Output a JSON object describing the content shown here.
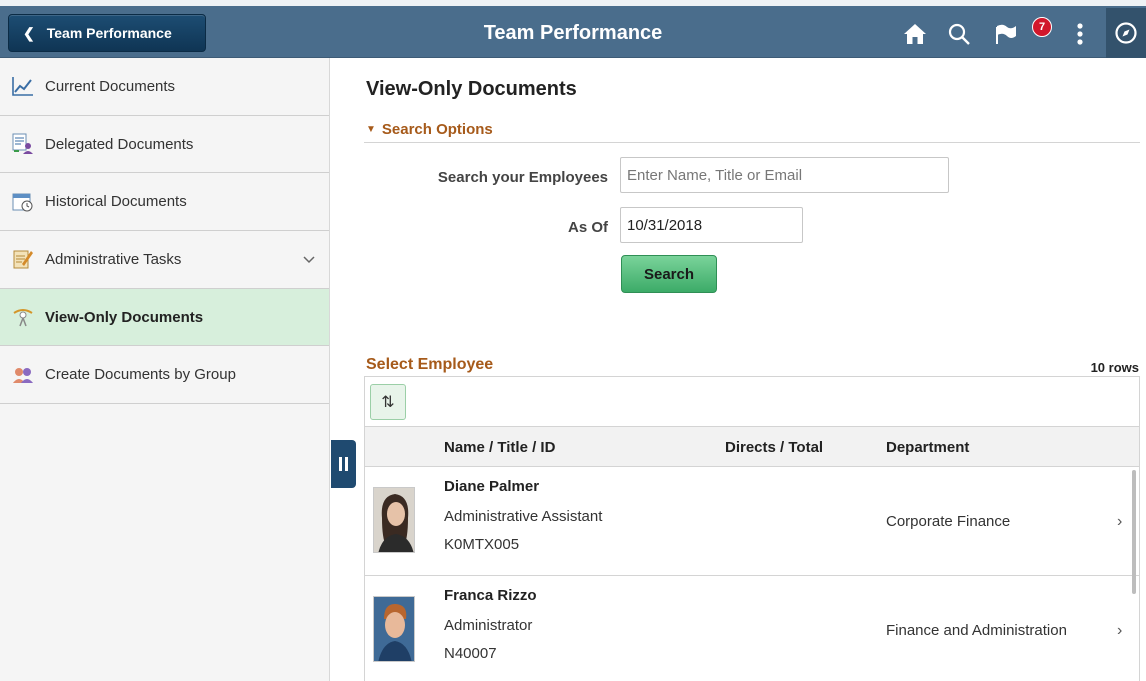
{
  "header": {
    "back_label": "Team Performance",
    "title": "Team Performance",
    "notification_count": "7",
    "icons": [
      "home-icon",
      "search-icon",
      "flag-icon",
      "more-options-icon",
      "navbar-icon"
    ]
  },
  "sidebar": {
    "items": [
      {
        "label": "Current Documents",
        "icon": "chart-icon"
      },
      {
        "label": "Delegated Documents",
        "icon": "delegated-icon"
      },
      {
        "label": "Historical Documents",
        "icon": "calendar-clock-icon"
      },
      {
        "label": "Administrative Tasks",
        "icon": "admin-tasks-icon"
      },
      {
        "label": "View-Only Documents",
        "icon": "view-only-icon"
      },
      {
        "label": "Create Documents by Group",
        "icon": "group-icon"
      }
    ],
    "active_index": 4
  },
  "main": {
    "title": "View-Only Documents",
    "search_options_label": "Search Options",
    "search_label": "Search your Employees",
    "search_placeholder": "Enter Name, Title or Email",
    "as_of_label": "As Of",
    "as_of_value": "10/31/2018",
    "search_button": "Search",
    "section_title": "Select Employee",
    "row_count": "10 rows",
    "columns": [
      "Name / Title / ID",
      "Directs / Total",
      "Department"
    ],
    "rows": [
      {
        "name": "Diane Palmer",
        "title": "Administrative Assistant",
        "id": "K0MTX005",
        "department": "Corporate Finance"
      },
      {
        "name": "Franca Rizzo",
        "title": "Administrator",
        "id": "N40007",
        "department": "Finance and Administration"
      }
    ]
  },
  "colors": {
    "header_bg": "#4a6d8c",
    "accent_orange": "#a65a1a",
    "active_item_bg": "#d7efdc",
    "button_green": "#3cab68",
    "badge_red": "#d1172b"
  }
}
